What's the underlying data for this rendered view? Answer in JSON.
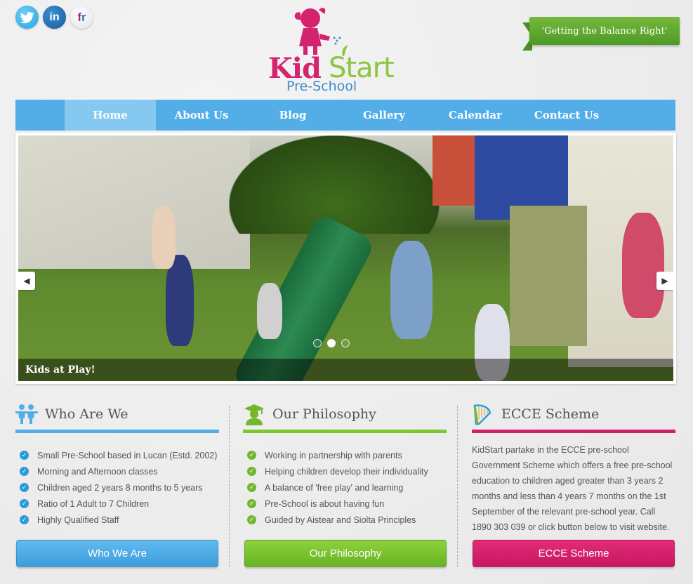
{
  "social": {
    "twitter_icon": "twitter-icon",
    "linkedin_label": "in",
    "french_label_f": "f",
    "french_label_r": "r"
  },
  "logo": {
    "kid": "Kid",
    "start": "Start",
    "pre": "Pre-School"
  },
  "ribbon": {
    "text": "'Getting the Balance Right'"
  },
  "nav": {
    "items": [
      "Home",
      "About Us",
      "Blog",
      "Gallery",
      "Calendar",
      "Contact Us"
    ],
    "active": "Home"
  },
  "slider": {
    "caption": "Kids at Play!",
    "dots_count": 3,
    "active_dot": 2,
    "prev_icon": "chevron-left-icon",
    "next_icon": "chevron-right-icon"
  },
  "who": {
    "title": "Who Are We",
    "items": [
      "Small Pre-School based in Lucan (Estd. 2002)",
      "Morning and Afternoon classes",
      "Children aged 2 years 8 months to 5 years",
      "Ratio of 1 Adult to 7 Children",
      "Highly Qualified Staff"
    ],
    "button": "Who We Are"
  },
  "philosophy": {
    "title": "Our Philosophy",
    "items": [
      "Working in partnership with parents",
      "Helping children develop their individuality",
      "A balance of 'free play' and learning",
      "Pre-School is about having fun",
      "Guided by Aistear and Siolta Principles"
    ],
    "button": "Our Philosophy"
  },
  "ecce": {
    "title": "ECCE Scheme",
    "text": "KidStart partake in the ECCE pre-school Government Scheme which offers a free pre-school education to children aged greater than 3 years 2 months and less than 4 years 7 months on the 1st September of the relevant pre-school year. Call 1890 303 039 or click button below to visit website.",
    "button": "ECCE Scheme"
  },
  "colors": {
    "blue": "#53aee8",
    "green": "#7ec62f",
    "pink": "#d31e6a"
  }
}
